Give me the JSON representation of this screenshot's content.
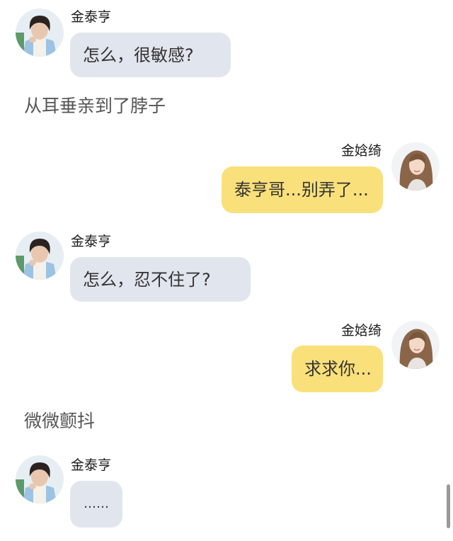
{
  "chat": {
    "sender_a": "金泰亨",
    "sender_b": "金娢绮",
    "msg1": "怎么，很敏感?",
    "narration1": "从耳垂亲到了脖子",
    "msg2": "泰亨哥...别弄了...",
    "msg3": "怎么，忍不住了?",
    "msg4": "求求你...",
    "narration2": "微微颤抖",
    "msg5": "……"
  },
  "colors": {
    "bubble_gray": "#e1e5ee",
    "bubble_yellow": "#f9e07a"
  },
  "icons": {
    "avatar_a": "avatar-male",
    "avatar_b": "avatar-female"
  }
}
